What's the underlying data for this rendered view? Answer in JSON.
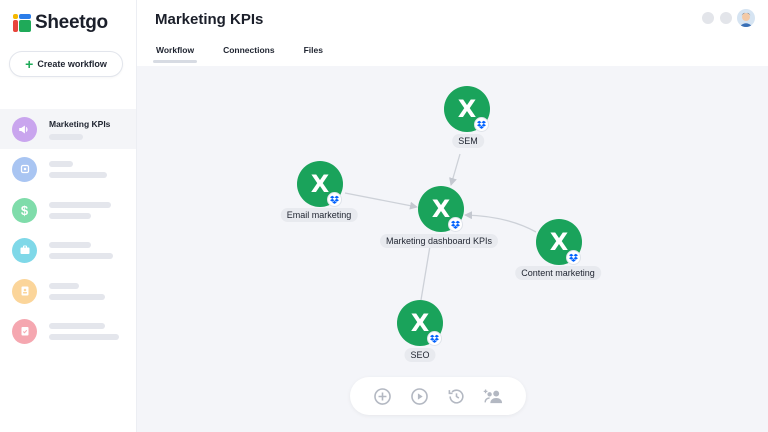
{
  "app": {
    "name": "Sheetgo",
    "create_button_label": "Create workflow"
  },
  "sidebar": {
    "items": [
      {
        "label": "Marketing KPIs",
        "icon": "megaphone-icon",
        "color": "#c9a5ee",
        "active": true
      },
      {
        "label": "",
        "icon": "gear-icon",
        "color": "#a9c5f2"
      },
      {
        "label": "",
        "icon": "dollar-icon",
        "color": "#7fdcaa"
      },
      {
        "label": "",
        "icon": "briefcase-icon",
        "color": "#7fd8e8"
      },
      {
        "label": "",
        "icon": "id-badge-icon",
        "color": "#fbd59a"
      },
      {
        "label": "",
        "icon": "clipboard-check-icon",
        "color": "#f5a7b0"
      }
    ]
  },
  "header": {
    "title": "Marketing KPIs",
    "tabs": [
      {
        "label": "Workflow",
        "active": true
      },
      {
        "label": "Connections",
        "active": false
      },
      {
        "label": "Files",
        "active": false
      }
    ]
  },
  "workflow": {
    "node_glyph": "X",
    "nodes": [
      {
        "id": "sem",
        "label": "SEM"
      },
      {
        "id": "email",
        "label": "Email marketing"
      },
      {
        "id": "dashboard",
        "label": "Marketing dashboard KPIs"
      },
      {
        "id": "content",
        "label": "Content marketing"
      },
      {
        "id": "seo",
        "label": "SEO"
      }
    ]
  },
  "toolbar": {
    "tools": [
      "add-circle-icon",
      "play-circle-icon",
      "history-icon",
      "share-users-icon"
    ]
  },
  "colors": {
    "node_green": "#1aa35b",
    "accent_green": "#1faa59",
    "dropbox_blue": "#0061fe"
  }
}
